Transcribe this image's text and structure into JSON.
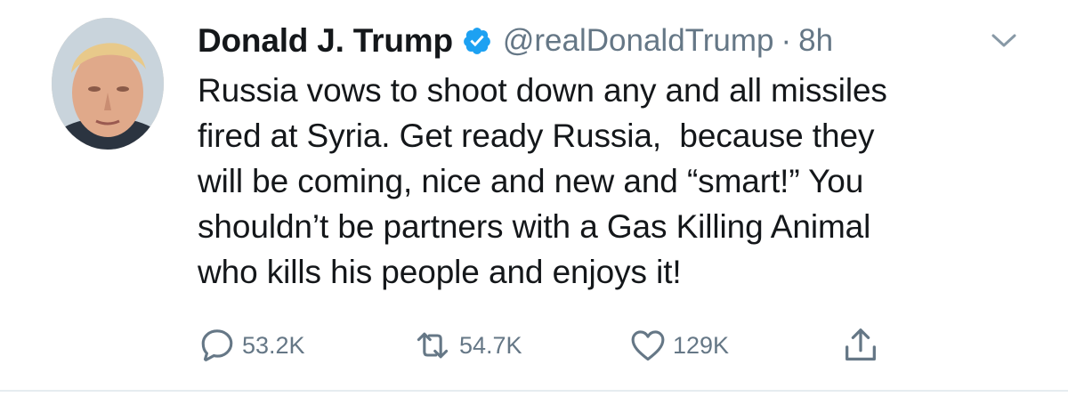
{
  "tweet": {
    "display_name": "Donald J. Trump",
    "handle": "@realDonaldTrump",
    "separator": "·",
    "time": "8h",
    "verified": true,
    "text": "Russia vows to shoot down any and all missiles\nfired at Syria. Get ready Russia,  because they\nwill be coming, nice and new and “smart!” You\nshouldn’t be partners with a Gas Killing Animal\nwho kills his people and enjoys it!"
  },
  "actions": {
    "replies": "53.2K",
    "retweets": "54.7K",
    "likes": "129K"
  },
  "icons": {
    "verified": "verified-badge-icon",
    "menu": "chevron-down-icon",
    "reply": "reply-icon",
    "retweet": "retweet-icon",
    "like": "heart-icon",
    "share": "share-icon"
  },
  "colors": {
    "text": "#14171a",
    "secondary": "#657786",
    "verified_blue": "#1da1f2",
    "divider": "#e6ecf0"
  }
}
